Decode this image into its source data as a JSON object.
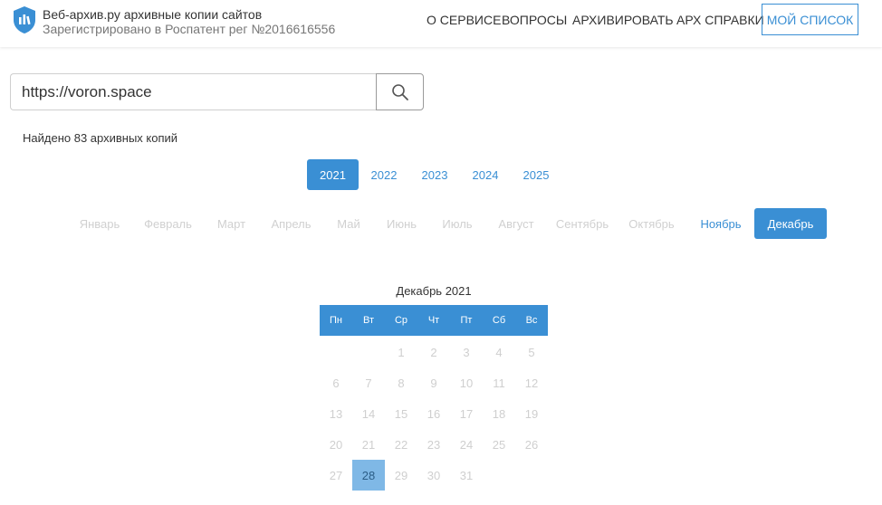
{
  "header": {
    "title": "Веб-архив.ру архивные копии сайтов",
    "subtitle": "Зарегистрировано в Роспатент рег №2016616556",
    "nav": [
      "О СЕРВИСЕ",
      "ВОПРОСЫ",
      "АРХИВИРОВАТЬ",
      "АРХ СПРАВКИ"
    ],
    "my_list": "МОЙ СПИСОК"
  },
  "search": {
    "value": "https://voron.space",
    "placeholder": ""
  },
  "results": {
    "found_text": "Найдено 83 архивных копий"
  },
  "years": [
    {
      "label": "2021",
      "active": true
    },
    {
      "label": "2022",
      "active": false
    },
    {
      "label": "2023",
      "active": false
    },
    {
      "label": "2024",
      "active": false
    },
    {
      "label": "2025",
      "active": false
    }
  ],
  "months": [
    {
      "label": "Январь",
      "state": "disabled"
    },
    {
      "label": "Февраль",
      "state": "disabled"
    },
    {
      "label": "Март",
      "state": "disabled"
    },
    {
      "label": "Апрель",
      "state": "disabled"
    },
    {
      "label": "Май",
      "state": "disabled"
    },
    {
      "label": "Июнь",
      "state": "disabled"
    },
    {
      "label": "Июль",
      "state": "disabled"
    },
    {
      "label": "Август",
      "state": "disabled"
    },
    {
      "label": "Сентябрь",
      "state": "disabled"
    },
    {
      "label": "Октябрь",
      "state": "disabled"
    },
    {
      "label": "Ноябрь",
      "state": "link"
    },
    {
      "label": "Декабрь",
      "state": "active"
    }
  ],
  "calendar": {
    "title": "Декабрь 2021",
    "weekdays": [
      "Пн",
      "Вт",
      "Ср",
      "Чт",
      "Пт",
      "Сб",
      "Вс"
    ],
    "leading_blanks": 2,
    "days": [
      "1",
      "2",
      "3",
      "4",
      "5",
      "6",
      "7",
      "8",
      "9",
      "10",
      "11",
      "12",
      "13",
      "14",
      "15",
      "16",
      "17",
      "18",
      "19",
      "20",
      "21",
      "22",
      "23",
      "24",
      "25",
      "26",
      "27",
      "28",
      "29",
      "30",
      "31"
    ],
    "archived_days": [
      "28"
    ]
  },
  "colors": {
    "accent": "#3a8fd4",
    "highlight": "#7fb8e6",
    "disabled": "#d0d0d0"
  }
}
